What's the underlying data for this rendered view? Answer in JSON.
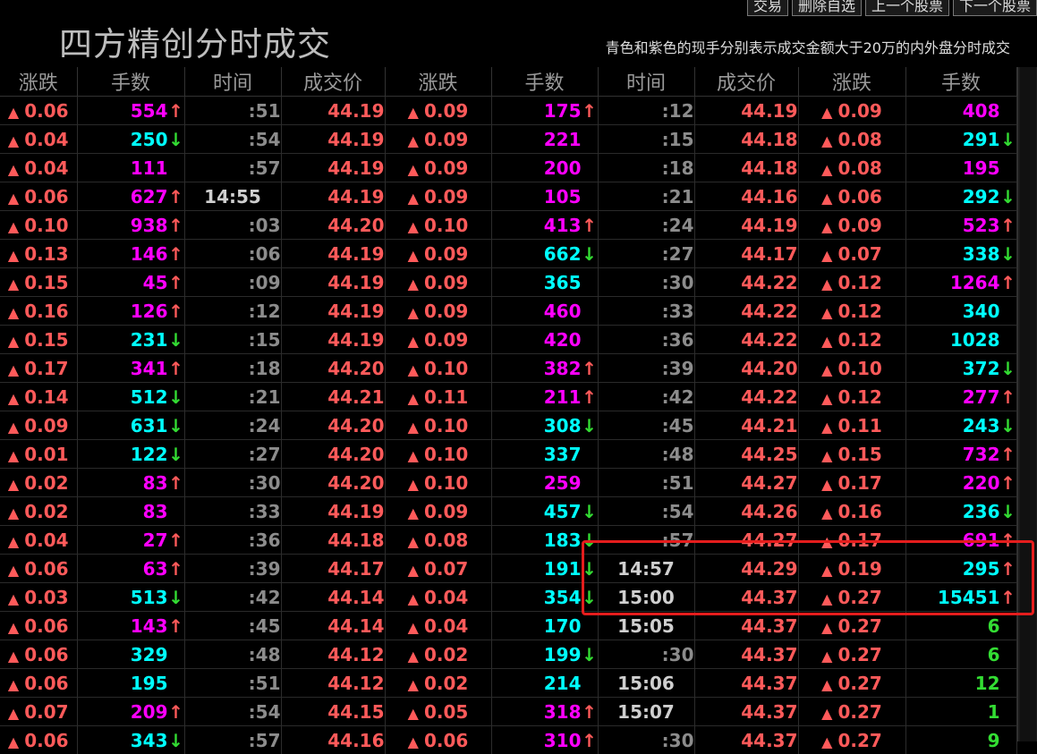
{
  "toolbar": {
    "trade": "交易",
    "remove_watch": "删除自选",
    "prev_stock": "上一个股票",
    "next_stock": "下一个股票"
  },
  "title": "四方精创分时成交",
  "subtitle": "青色和紫色的现手分别表示成交金额大于20万的内外盘分时成交",
  "headers": [
    "涨跌",
    "手数",
    "时间",
    "成交价",
    "涨跌",
    "手数",
    "时间",
    "成交价",
    "涨跌",
    "手数"
  ],
  "colors": {
    "up": "#ff5a5a",
    "down": "#33dd33",
    "magenta": "#ff00ff",
    "cyan": "#00ffff",
    "green": "#33dd33",
    "highlight": "#e51d1d"
  },
  "rows": [
    [
      {
        "chg": "0.06",
        "vol": "554",
        "vc": "magenta",
        "dir": "up",
        "time": ":51",
        "tfull": false,
        "price": "44.19"
      },
      {
        "chg": "0.09",
        "vol": "175",
        "vc": "magenta",
        "dir": "up",
        "time": ":12",
        "tfull": false,
        "price": "44.19"
      },
      {
        "chg": "0.09",
        "vol": "408",
        "vc": "magenta",
        "dir": ""
      }
    ],
    [
      {
        "chg": "0.04",
        "vol": "250",
        "vc": "cyan",
        "dir": "down",
        "time": ":54",
        "tfull": false,
        "price": "44.19"
      },
      {
        "chg": "0.09",
        "vol": "221",
        "vc": "magenta",
        "dir": "",
        "time": ":15",
        "tfull": false,
        "price": "44.18"
      },
      {
        "chg": "0.08",
        "vol": "291",
        "vc": "cyan",
        "dir": "down"
      }
    ],
    [
      {
        "chg": "0.04",
        "vol": "111",
        "vc": "magenta",
        "dir": "",
        "time": ":57",
        "tfull": false,
        "price": "44.19"
      },
      {
        "chg": "0.09",
        "vol": "200",
        "vc": "magenta",
        "dir": "",
        "time": ":18",
        "tfull": false,
        "price": "44.18"
      },
      {
        "chg": "0.08",
        "vol": "195",
        "vc": "magenta",
        "dir": ""
      }
    ],
    [
      {
        "chg": "0.06",
        "vol": "627",
        "vc": "magenta",
        "dir": "up",
        "time": "14:55",
        "tfull": true,
        "price": "44.19"
      },
      {
        "chg": "0.09",
        "vol": "105",
        "vc": "magenta",
        "dir": "",
        "time": ":21",
        "tfull": false,
        "price": "44.16"
      },
      {
        "chg": "0.06",
        "vol": "292",
        "vc": "cyan",
        "dir": "down"
      }
    ],
    [
      {
        "chg": "0.10",
        "vol": "938",
        "vc": "magenta",
        "dir": "up",
        "time": ":03",
        "tfull": false,
        "price": "44.20"
      },
      {
        "chg": "0.10",
        "vol": "413",
        "vc": "magenta",
        "dir": "up",
        "time": ":24",
        "tfull": false,
        "price": "44.19"
      },
      {
        "chg": "0.09",
        "vol": "523",
        "vc": "magenta",
        "dir": "up"
      }
    ],
    [
      {
        "chg": "0.13",
        "vol": "146",
        "vc": "magenta",
        "dir": "up",
        "time": ":06",
        "tfull": false,
        "price": "44.19"
      },
      {
        "chg": "0.09",
        "vol": "662",
        "vc": "cyan",
        "dir": "down",
        "time": ":27",
        "tfull": false,
        "price": "44.17"
      },
      {
        "chg": "0.07",
        "vol": "338",
        "vc": "cyan",
        "dir": "down"
      }
    ],
    [
      {
        "chg": "0.15",
        "vol": "45",
        "vc": "magenta",
        "dir": "up",
        "time": ":09",
        "tfull": false,
        "price": "44.19"
      },
      {
        "chg": "0.09",
        "vol": "365",
        "vc": "cyan",
        "dir": "",
        "time": ":30",
        "tfull": false,
        "price": "44.22"
      },
      {
        "chg": "0.12",
        "vol": "1264",
        "vc": "magenta",
        "dir": "up"
      }
    ],
    [
      {
        "chg": "0.16",
        "vol": "126",
        "vc": "magenta",
        "dir": "up",
        "time": ":12",
        "tfull": false,
        "price": "44.19"
      },
      {
        "chg": "0.09",
        "vol": "460",
        "vc": "magenta",
        "dir": "",
        "time": ":33",
        "tfull": false,
        "price": "44.22"
      },
      {
        "chg": "0.12",
        "vol": "340",
        "vc": "cyan",
        "dir": ""
      }
    ],
    [
      {
        "chg": "0.15",
        "vol": "231",
        "vc": "cyan",
        "dir": "down",
        "time": ":15",
        "tfull": false,
        "price": "44.19"
      },
      {
        "chg": "0.09",
        "vol": "420",
        "vc": "magenta",
        "dir": "",
        "time": ":36",
        "tfull": false,
        "price": "44.22"
      },
      {
        "chg": "0.12",
        "vol": "1028",
        "vc": "cyan",
        "dir": ""
      }
    ],
    [
      {
        "chg": "0.17",
        "vol": "341",
        "vc": "magenta",
        "dir": "up",
        "time": ":18",
        "tfull": false,
        "price": "44.20"
      },
      {
        "chg": "0.10",
        "vol": "382",
        "vc": "magenta",
        "dir": "up",
        "time": ":39",
        "tfull": false,
        "price": "44.20"
      },
      {
        "chg": "0.10",
        "vol": "372",
        "vc": "cyan",
        "dir": "down"
      }
    ],
    [
      {
        "chg": "0.14",
        "vol": "512",
        "vc": "cyan",
        "dir": "down",
        "time": ":21",
        "tfull": false,
        "price": "44.21"
      },
      {
        "chg": "0.11",
        "vol": "211",
        "vc": "magenta",
        "dir": "up",
        "time": ":42",
        "tfull": false,
        "price": "44.22"
      },
      {
        "chg": "0.12",
        "vol": "277",
        "vc": "magenta",
        "dir": "up"
      }
    ],
    [
      {
        "chg": "0.09",
        "vol": "631",
        "vc": "cyan",
        "dir": "down",
        "time": ":24",
        "tfull": false,
        "price": "44.20"
      },
      {
        "chg": "0.10",
        "vol": "308",
        "vc": "cyan",
        "dir": "down",
        "time": ":45",
        "tfull": false,
        "price": "44.21"
      },
      {
        "chg": "0.11",
        "vol": "243",
        "vc": "cyan",
        "dir": "down"
      }
    ],
    [
      {
        "chg": "0.01",
        "vol": "122",
        "vc": "cyan",
        "dir": "down",
        "time": ":27",
        "tfull": false,
        "price": "44.20"
      },
      {
        "chg": "0.10",
        "vol": "337",
        "vc": "cyan",
        "dir": "",
        "time": ":48",
        "tfull": false,
        "price": "44.25"
      },
      {
        "chg": "0.15",
        "vol": "732",
        "vc": "magenta",
        "dir": "up"
      }
    ],
    [
      {
        "chg": "0.02",
        "vol": "83",
        "vc": "magenta",
        "dir": "up",
        "time": ":30",
        "tfull": false,
        "price": "44.20"
      },
      {
        "chg": "0.10",
        "vol": "259",
        "vc": "magenta",
        "dir": "",
        "time": ":51",
        "tfull": false,
        "price": "44.27"
      },
      {
        "chg": "0.17",
        "vol": "220",
        "vc": "magenta",
        "dir": "up"
      }
    ],
    [
      {
        "chg": "0.02",
        "vol": "83",
        "vc": "magenta",
        "dir": "",
        "time": ":33",
        "tfull": false,
        "price": "44.19"
      },
      {
        "chg": "0.09",
        "vol": "457",
        "vc": "cyan",
        "dir": "down",
        "time": ":54",
        "tfull": false,
        "price": "44.26"
      },
      {
        "chg": "0.16",
        "vol": "236",
        "vc": "cyan",
        "dir": "down"
      }
    ],
    [
      {
        "chg": "0.04",
        "vol": "27",
        "vc": "magenta",
        "dir": "up",
        "time": ":36",
        "tfull": false,
        "price": "44.18"
      },
      {
        "chg": "0.08",
        "vol": "183",
        "vc": "cyan",
        "dir": "down",
        "time": ":57",
        "tfull": false,
        "price": "44.27"
      },
      {
        "chg": "0.17",
        "vol": "691",
        "vc": "magenta",
        "dir": "up"
      }
    ],
    [
      {
        "chg": "0.06",
        "vol": "63",
        "vc": "magenta",
        "dir": "up",
        "time": ":39",
        "tfull": false,
        "price": "44.17"
      },
      {
        "chg": "0.07",
        "vol": "191",
        "vc": "cyan",
        "dir": "down",
        "time": "14:57",
        "tfull": true,
        "price": "44.29"
      },
      {
        "chg": "0.19",
        "vol": "295",
        "vc": "cyan",
        "dir": "up"
      }
    ],
    [
      {
        "chg": "0.03",
        "vol": "513",
        "vc": "cyan",
        "dir": "down",
        "time": ":42",
        "tfull": false,
        "price": "44.14"
      },
      {
        "chg": "0.04",
        "vol": "354",
        "vc": "cyan",
        "dir": "down",
        "time": "15:00",
        "tfull": true,
        "price": "44.37"
      },
      {
        "chg": "0.27",
        "vol": "15451",
        "vc": "cyan",
        "dir": "up"
      }
    ],
    [
      {
        "chg": "0.06",
        "vol": "143",
        "vc": "magenta",
        "dir": "up",
        "time": ":45",
        "tfull": false,
        "price": "44.14"
      },
      {
        "chg": "0.04",
        "vol": "170",
        "vc": "cyan",
        "dir": "",
        "time": "15:05",
        "tfull": true,
        "price": "44.37"
      },
      {
        "chg": "0.27",
        "vol": "6",
        "vc": "green",
        "dir": ""
      }
    ],
    [
      {
        "chg": "0.06",
        "vol": "329",
        "vc": "cyan",
        "dir": "",
        "time": ":48",
        "tfull": false,
        "price": "44.12"
      },
      {
        "chg": "0.02",
        "vol": "199",
        "vc": "cyan",
        "dir": "down",
        "time": ":30",
        "tfull": false,
        "price": "44.37"
      },
      {
        "chg": "0.27",
        "vol": "6",
        "vc": "green",
        "dir": ""
      }
    ],
    [
      {
        "chg": "0.06",
        "vol": "195",
        "vc": "cyan",
        "dir": "",
        "time": ":51",
        "tfull": false,
        "price": "44.12"
      },
      {
        "chg": "0.02",
        "vol": "214",
        "vc": "cyan",
        "dir": "",
        "time": "15:06",
        "tfull": true,
        "price": "44.37"
      },
      {
        "chg": "0.27",
        "vol": "12",
        "vc": "green",
        "dir": ""
      }
    ],
    [
      {
        "chg": "0.07",
        "vol": "209",
        "vc": "magenta",
        "dir": "up",
        "time": ":54",
        "tfull": false,
        "price": "44.15"
      },
      {
        "chg": "0.05",
        "vol": "318",
        "vc": "magenta",
        "dir": "up",
        "time": "15:07",
        "tfull": true,
        "price": "44.37"
      },
      {
        "chg": "0.27",
        "vol": "1",
        "vc": "green",
        "dir": ""
      }
    ],
    [
      {
        "chg": "0.06",
        "vol": "343",
        "vc": "cyan",
        "dir": "down",
        "time": ":57",
        "tfull": false,
        "price": "44.16"
      },
      {
        "chg": "0.06",
        "vol": "310",
        "vc": "magenta",
        "dir": "up",
        "time": ":30",
        "tfull": false,
        "price": "44.37"
      },
      {
        "chg": "0.27",
        "vol": "9",
        "vc": "green",
        "dir": ""
      }
    ]
  ]
}
